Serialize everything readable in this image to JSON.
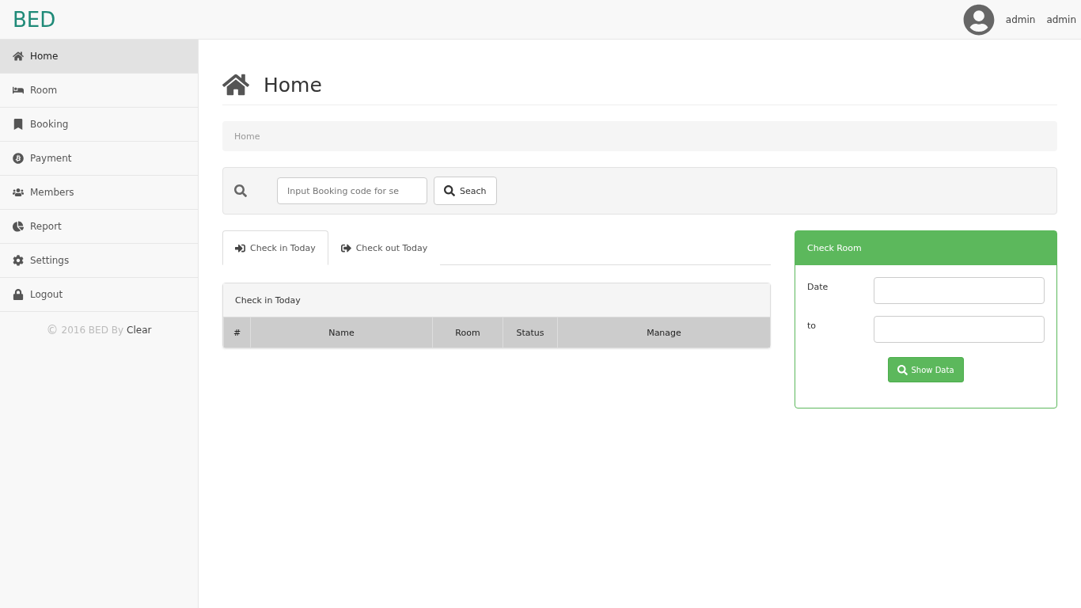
{
  "brand": "BED",
  "user": {
    "name": "admin",
    "role": "admin"
  },
  "sidebar": {
    "items": [
      {
        "label": "Home",
        "selected": true
      },
      {
        "label": "Room",
        "selected": false
      },
      {
        "label": "Booking",
        "selected": false
      },
      {
        "label": "Payment",
        "selected": false
      },
      {
        "label": "Members",
        "selected": false
      },
      {
        "label": "Report",
        "selected": false
      },
      {
        "label": "Settings",
        "selected": false
      },
      {
        "label": "Logout",
        "selected": false
      }
    ],
    "footer": {
      "symbol": "©",
      "text": "2016 BED By",
      "link": "Clear"
    }
  },
  "page_title": "Home",
  "breadcrumb": "Home",
  "search": {
    "placeholder": "Input Booking code for se",
    "button": "Seach"
  },
  "tabs": [
    {
      "label": "Check in Today",
      "selected": true
    },
    {
      "label": "Check out Today",
      "selected": false
    }
  ],
  "table": {
    "title": "Check in Today",
    "columns": [
      "#",
      "Name",
      "Room",
      "Status",
      "Manage"
    ]
  },
  "check_room": {
    "title": "Check Room",
    "fields": [
      {
        "label": "Date"
      },
      {
        "label": "to"
      }
    ],
    "button": "Show Data"
  }
}
